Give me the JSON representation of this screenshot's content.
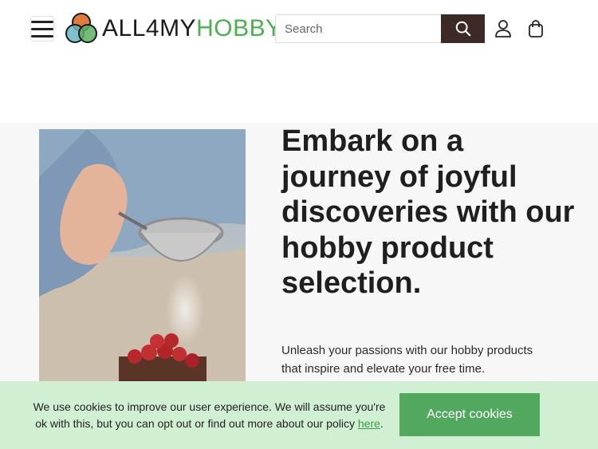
{
  "header": {
    "logo": {
      "text_part1": "ALL4MY",
      "text_part2": "HOBBY"
    },
    "search": {
      "placeholder": "Search",
      "value": ""
    },
    "icons": {
      "menu": "hamburger-menu-icon",
      "search": "search-icon",
      "account": "user-icon",
      "cart": "shopping-bag-icon"
    }
  },
  "hero": {
    "title": "Embark on a journey of joyful discoveries with our hobby product selection.",
    "subtitle": "Unleash your passions with our hobby products that inspire and elevate your free time.",
    "image_alt": "baking-photo"
  },
  "cookie_banner": {
    "text": "We use cookies to improve our user experience. We will assume you're ok with this, but you can opt out or find out more about our policy ",
    "link_text": "here",
    "after_link": ".",
    "button_label": "Accept cookies"
  },
  "colors": {
    "brand_green": "#4caf50",
    "search_button": "#3d2a26",
    "cookie_bg": "#d1efd3",
    "accept_button": "#53a860"
  }
}
